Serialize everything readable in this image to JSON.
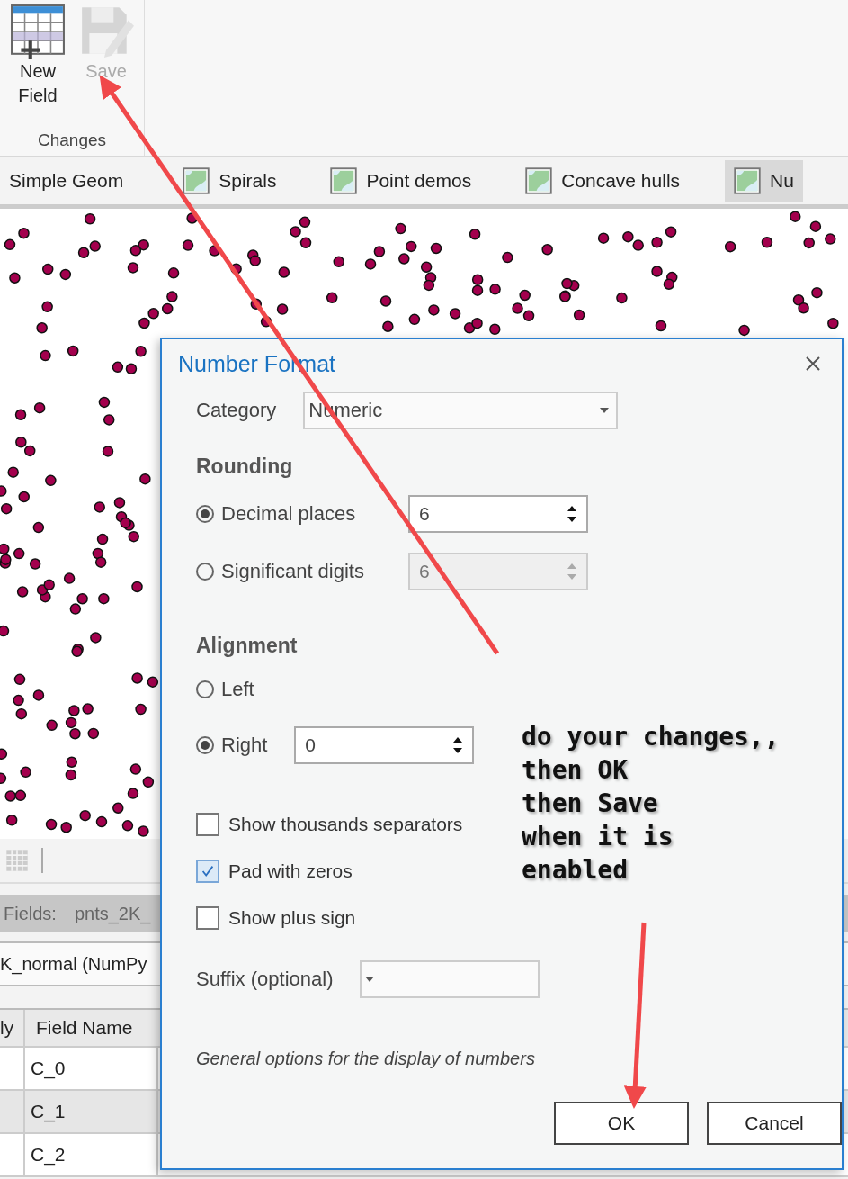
{
  "ribbon": {
    "buttons": [
      {
        "label": "New Field",
        "disabled": false
      },
      {
        "label": "Save",
        "disabled": true
      }
    ],
    "group_label": "Changes"
  },
  "map_tabs": [
    {
      "label": "Simple Geom",
      "has_icon": false,
      "selected": false
    },
    {
      "label": "Spirals",
      "has_icon": true,
      "selected": false
    },
    {
      "label": "Point demos",
      "has_icon": true,
      "selected": false
    },
    {
      "label": "Concave hulls",
      "has_icon": true,
      "selected": false
    },
    {
      "label": "Nu",
      "has_icon": true,
      "selected": true
    }
  ],
  "fields_view": {
    "title": "Fields:",
    "layer": "pnts_2K_",
    "source": "K_normal (NumPy",
    "columns": [
      "ly",
      "Field Name"
    ],
    "rows": [
      {
        "field_name": "C_0",
        "selected": false
      },
      {
        "field_name": "C_1",
        "selected": true
      },
      {
        "field_name": "C_2",
        "selected": false
      }
    ]
  },
  "dialog": {
    "title": "Number Format",
    "category_label": "Category",
    "category_value": "Numeric",
    "rounding_heading": "Rounding",
    "rounding": [
      {
        "label": "Decimal places",
        "value": "6",
        "selected": true
      },
      {
        "label": "Significant digits",
        "value": "6",
        "selected": false
      }
    ],
    "alignment_heading": "Alignment",
    "alignment": [
      {
        "label": "Left",
        "selected": false
      },
      {
        "label": "Right",
        "value": "0",
        "selected": true
      }
    ],
    "options": [
      {
        "label": "Show thousands separators",
        "checked": false
      },
      {
        "label": "Pad with zeros",
        "checked": true
      },
      {
        "label": "Show plus sign",
        "checked": false
      }
    ],
    "suffix_label": "Suffix (optional)",
    "description": "General options for the display of numbers",
    "buttons": [
      "OK",
      "Cancel"
    ]
  },
  "annotation": {
    "lines": [
      "do your changes,,",
      "then OK",
      "then Save",
      "when it is",
      "enabled"
    ]
  }
}
